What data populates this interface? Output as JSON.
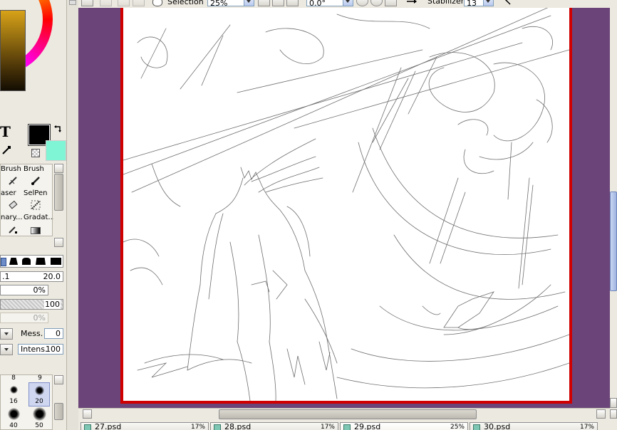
{
  "toolbar": {
    "selection_label": "Selection",
    "zoom_value": "25%",
    "rotation_value": "0.0°",
    "stabilizer_label": "Stabilizer",
    "stabilizer_value": "13"
  },
  "color": {
    "primary": "#000000",
    "secondary": "#7ff5d5",
    "wheel_inner_gradient": [
      "#c79a2e",
      "#1a1305"
    ]
  },
  "tools": [
    {
      "label": "Brush",
      "icon": "brush-icon"
    },
    {
      "label": "Brush",
      "icon": "brush-icon"
    },
    {
      "label": "aser",
      "icon": "eraser-icon"
    },
    {
      "label": "SelPen",
      "icon": "selpen-icon"
    },
    {
      "label": "nary...",
      "icon": "binary-pen-icon"
    },
    {
      "label": "Gradat...",
      "icon": "gradation-icon"
    }
  ],
  "text_tool_glyph": "T",
  "brush_settings": {
    "size_min": ".1",
    "size_max": "20.0",
    "min_size_pct": "0%",
    "density": "100",
    "texture_pct": "0%",
    "mess_label": "Mess.",
    "mess_value": "0",
    "intens_label": "Intens.",
    "intens_value": "100"
  },
  "brush_sizes": {
    "row0": [
      "8",
      "9"
    ],
    "row1": [
      "16",
      "20"
    ],
    "row2": [
      "40",
      "50"
    ]
  },
  "document_tabs": [
    {
      "name": "27.psd",
      "zoom": "17%"
    },
    {
      "name": "28.psd",
      "zoom": "17%"
    },
    {
      "name": "29.psd",
      "zoom": "25%"
    },
    {
      "name": "30.psd",
      "zoom": "17%"
    }
  ]
}
